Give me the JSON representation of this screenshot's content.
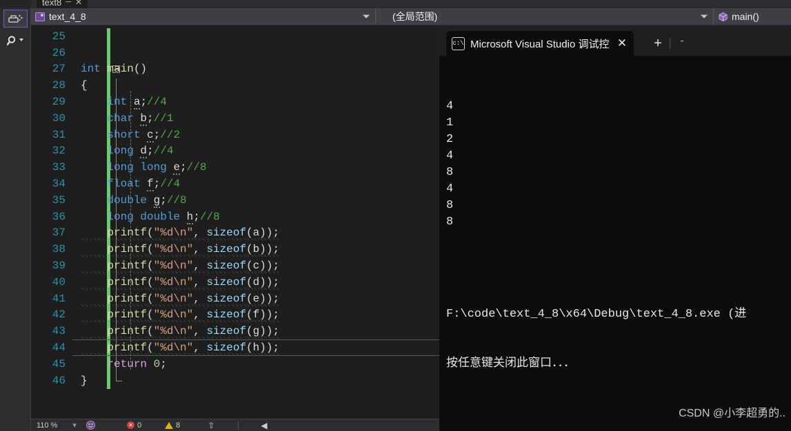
{
  "window": {
    "background_color": "#1e1e1e"
  },
  "left_rail": {
    "items": [
      {
        "name": "toolbox-icon",
        "label": "toolbox",
        "selected": true
      },
      {
        "name": "search-icon",
        "label": "search",
        "selected": false
      }
    ]
  },
  "top_tabstrip": {
    "ghost_tab": {
      "label": "text8",
      "pin": "─",
      "close": "✕"
    }
  },
  "navbar": {
    "file_selector": {
      "icon": "cs-file-icon",
      "value": "text_4_8",
      "caret": "▾"
    },
    "scope_selector": {
      "value": "(全局范围)",
      "caret": "▾"
    },
    "member_selector": {
      "icon": "method-cube-icon",
      "value": "main()"
    }
  },
  "editor": {
    "first_line_number": 25,
    "current_line": 44,
    "lines": [
      {
        "num": 25,
        "tokens": []
      },
      {
        "num": 26,
        "tokens": []
      },
      {
        "num": 27,
        "tokens": [
          {
            "t": "int ",
            "c": "k-type"
          },
          {
            "t": "main",
            "c": "k-fn"
          },
          {
            "t": "()",
            "c": "k-pun"
          }
        ],
        "indent": 0,
        "collapse": true
      },
      {
        "num": 28,
        "tokens": [
          {
            "t": "{",
            "c": "k-pun"
          }
        ],
        "indent": 0
      },
      {
        "num": 29,
        "tokens": [
          {
            "t": "    ",
            "c": "k-pun"
          },
          {
            "t": "int",
            "c": "k-type"
          },
          {
            "t": " ",
            "c": "k-pun"
          },
          {
            "t": "a",
            "c": "k-pun",
            "dot": true
          },
          {
            "t": ";",
            "c": "k-pun"
          },
          {
            "t": "//4",
            "c": "k-cmt"
          }
        ]
      },
      {
        "num": 30,
        "tokens": [
          {
            "t": "    ",
            "c": "k-pun"
          },
          {
            "t": "char",
            "c": "k-type"
          },
          {
            "t": " ",
            "c": "k-pun"
          },
          {
            "t": "b",
            "c": "k-pun",
            "dot": true
          },
          {
            "t": ";",
            "c": "k-pun"
          },
          {
            "t": "//1",
            "c": "k-cmt"
          }
        ]
      },
      {
        "num": 31,
        "tokens": [
          {
            "t": "    ",
            "c": "k-pun"
          },
          {
            "t": "short",
            "c": "k-type"
          },
          {
            "t": " ",
            "c": "k-pun"
          },
          {
            "t": "c",
            "c": "k-pun",
            "dot": true
          },
          {
            "t": ";",
            "c": "k-pun"
          },
          {
            "t": "//2",
            "c": "k-cmt"
          }
        ]
      },
      {
        "num": 32,
        "tokens": [
          {
            "t": "    ",
            "c": "k-pun"
          },
          {
            "t": "long",
            "c": "k-type"
          },
          {
            "t": " ",
            "c": "k-pun"
          },
          {
            "t": "d",
            "c": "k-pun",
            "dot": true
          },
          {
            "t": ";",
            "c": "k-pun"
          },
          {
            "t": "//4",
            "c": "k-cmt"
          }
        ]
      },
      {
        "num": 33,
        "tokens": [
          {
            "t": "    ",
            "c": "k-pun"
          },
          {
            "t": "long long",
            "c": "k-type"
          },
          {
            "t": " ",
            "c": "k-pun"
          },
          {
            "t": "e",
            "c": "k-pun",
            "dot": true
          },
          {
            "t": ";",
            "c": "k-pun"
          },
          {
            "t": "//8",
            "c": "k-cmt"
          }
        ]
      },
      {
        "num": 34,
        "tokens": [
          {
            "t": "    ",
            "c": "k-pun"
          },
          {
            "t": "float",
            "c": "k-type"
          },
          {
            "t": " ",
            "c": "k-pun"
          },
          {
            "t": "f",
            "c": "k-pun",
            "dot": true
          },
          {
            "t": ";",
            "c": "k-pun"
          },
          {
            "t": "//4",
            "c": "k-cmt"
          }
        ]
      },
      {
        "num": 35,
        "tokens": [
          {
            "t": "    ",
            "c": "k-pun"
          },
          {
            "t": "double",
            "c": "k-type"
          },
          {
            "t": " ",
            "c": "k-pun"
          },
          {
            "t": "g",
            "c": "k-pun",
            "dot": true
          },
          {
            "t": ";",
            "c": "k-pun"
          },
          {
            "t": "//8",
            "c": "k-cmt"
          }
        ]
      },
      {
        "num": 36,
        "tokens": [
          {
            "t": "    ",
            "c": "k-pun"
          },
          {
            "t": "long double",
            "c": "k-type"
          },
          {
            "t": " ",
            "c": "k-pun"
          },
          {
            "t": "h",
            "c": "k-pun",
            "dot": true
          },
          {
            "t": ";",
            "c": "k-pun"
          },
          {
            "t": "//8",
            "c": "k-cmt"
          }
        ]
      },
      {
        "num": 37,
        "squiggle": true,
        "tokens": [
          {
            "t": "    ",
            "c": "k-pun"
          },
          {
            "t": "printf",
            "c": "k-fn"
          },
          {
            "t": "(",
            "c": "k-pun"
          },
          {
            "t": "\"%d\\n\"",
            "c": "k-str"
          },
          {
            "t": ", ",
            "c": "k-pun"
          },
          {
            "t": "sizeof",
            "c": "k-id"
          },
          {
            "t": "(",
            "c": "k-pun"
          },
          {
            "t": "a",
            "c": "k-pun"
          },
          {
            "t": "));",
            "c": "k-pun"
          }
        ]
      },
      {
        "num": 38,
        "squiggle": true,
        "tokens": [
          {
            "t": "    ",
            "c": "k-pun"
          },
          {
            "t": "printf",
            "c": "k-fn"
          },
          {
            "t": "(",
            "c": "k-pun"
          },
          {
            "t": "\"%d\\n\"",
            "c": "k-str"
          },
          {
            "t": ", ",
            "c": "k-pun"
          },
          {
            "t": "sizeof",
            "c": "k-id"
          },
          {
            "t": "(",
            "c": "k-pun"
          },
          {
            "t": "b",
            "c": "k-pun"
          },
          {
            "t": "));",
            "c": "k-pun"
          }
        ]
      },
      {
        "num": 39,
        "squiggle": true,
        "tokens": [
          {
            "t": "    ",
            "c": "k-pun"
          },
          {
            "t": "printf",
            "c": "k-fn"
          },
          {
            "t": "(",
            "c": "k-pun"
          },
          {
            "t": "\"%d\\n\"",
            "c": "k-str"
          },
          {
            "t": ", ",
            "c": "k-pun"
          },
          {
            "t": "sizeof",
            "c": "k-id"
          },
          {
            "t": "(",
            "c": "k-pun"
          },
          {
            "t": "c",
            "c": "k-pun"
          },
          {
            "t": "));",
            "c": "k-pun"
          }
        ]
      },
      {
        "num": 40,
        "squiggle": true,
        "tokens": [
          {
            "t": "    ",
            "c": "k-pun"
          },
          {
            "t": "printf",
            "c": "k-fn"
          },
          {
            "t": "(",
            "c": "k-pun"
          },
          {
            "t": "\"%d\\n\"",
            "c": "k-str"
          },
          {
            "t": ", ",
            "c": "k-pun"
          },
          {
            "t": "sizeof",
            "c": "k-id"
          },
          {
            "t": "(",
            "c": "k-pun"
          },
          {
            "t": "d",
            "c": "k-pun"
          },
          {
            "t": "));",
            "c": "k-pun"
          }
        ]
      },
      {
        "num": 41,
        "squiggle": true,
        "tokens": [
          {
            "t": "    ",
            "c": "k-pun"
          },
          {
            "t": "printf",
            "c": "k-fn"
          },
          {
            "t": "(",
            "c": "k-pun"
          },
          {
            "t": "\"%d\\n\"",
            "c": "k-str"
          },
          {
            "t": ", ",
            "c": "k-pun"
          },
          {
            "t": "sizeof",
            "c": "k-id"
          },
          {
            "t": "(",
            "c": "k-pun"
          },
          {
            "t": "e",
            "c": "k-pun"
          },
          {
            "t": "));",
            "c": "k-pun"
          }
        ]
      },
      {
        "num": 42,
        "squiggle": true,
        "tokens": [
          {
            "t": "    ",
            "c": "k-pun"
          },
          {
            "t": "printf",
            "c": "k-fn"
          },
          {
            "t": "(",
            "c": "k-pun"
          },
          {
            "t": "\"%d\\n\"",
            "c": "k-str"
          },
          {
            "t": ", ",
            "c": "k-pun"
          },
          {
            "t": "sizeof",
            "c": "k-id"
          },
          {
            "t": "(",
            "c": "k-pun"
          },
          {
            "t": "f",
            "c": "k-pun"
          },
          {
            "t": "));",
            "c": "k-pun"
          }
        ]
      },
      {
        "num": 43,
        "squiggle": true,
        "tokens": [
          {
            "t": "    ",
            "c": "k-pun"
          },
          {
            "t": "printf",
            "c": "k-fn"
          },
          {
            "t": "(",
            "c": "k-pun"
          },
          {
            "t": "\"%d\\n\"",
            "c": "k-str"
          },
          {
            "t": ", ",
            "c": "k-pun"
          },
          {
            "t": "sizeof",
            "c": "k-id"
          },
          {
            "t": "(",
            "c": "k-pun"
          },
          {
            "t": "g",
            "c": "k-pun"
          },
          {
            "t": "));",
            "c": "k-pun"
          }
        ]
      },
      {
        "num": 44,
        "squiggle": true,
        "tokens": [
          {
            "t": "    ",
            "c": "k-pun"
          },
          {
            "t": "printf",
            "c": "k-fn"
          },
          {
            "t": "(",
            "c": "k-pun"
          },
          {
            "t": "\"%d\\n\"",
            "c": "k-str"
          },
          {
            "t": ", ",
            "c": "k-pun"
          },
          {
            "t": "sizeof",
            "c": "k-id"
          },
          {
            "t": "(",
            "c": "k-pun"
          },
          {
            "t": "h",
            "c": "k-pun"
          },
          {
            "t": "));",
            "c": "k-pun"
          }
        ]
      },
      {
        "num": 45,
        "tokens": [
          {
            "t": "    ",
            "c": "k-pun"
          },
          {
            "t": "return",
            "c": "k-ret"
          },
          {
            "t": " ",
            "c": "k-pun"
          },
          {
            "t": "0",
            "c": "k-num"
          },
          {
            "t": ";",
            "c": "k-pun"
          }
        ]
      },
      {
        "num": 46,
        "tokens": [
          {
            "t": "}",
            "c": "k-pun"
          }
        ]
      }
    ]
  },
  "statusbar": {
    "zoom": "110 %",
    "ready_icon": "smiley-icon",
    "error_count": "0",
    "warning_count": "8",
    "up_arrow": "⇧",
    "left_arrow": "◀"
  },
  "console": {
    "tab": {
      "icon_text": "c:\\",
      "title": "Microsoft Visual Studio 调试控",
      "close": "✕"
    },
    "new_tab": "+",
    "dropdown": "ˇ",
    "output_lines": [
      "4",
      "1",
      "2",
      "4",
      "8",
      "4",
      "8",
      "8"
    ],
    "exit_line": "F:\\code\\text_4_8\\x64\\Debug\\text_4_8.exe (进",
    "prompt_line": "按任意键关闭此窗口．．．",
    "watermark": "CSDN @小李超勇的.."
  }
}
